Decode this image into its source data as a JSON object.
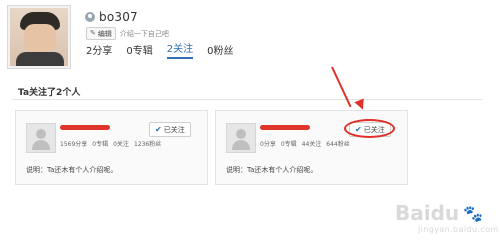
{
  "profile": {
    "username": "bo307",
    "edit_label": "编辑",
    "intro_text": "介绍一下自己吧",
    "tabs": [
      {
        "label": "2分享"
      },
      {
        "label": "0专辑"
      },
      {
        "label": "2关注"
      },
      {
        "label": "0粉丝"
      }
    ]
  },
  "following": {
    "title": "Ta关注了2个人",
    "cards": [
      {
        "stats": [
          "1569分享",
          "0专辑",
          "0关注",
          "1236粉丝"
        ],
        "follow_label": "已关注",
        "desc": "说明：Ta还木有个人介绍呢。"
      },
      {
        "stats": [
          "0分享",
          "0专辑",
          "44关注",
          "644粉丝"
        ],
        "follow_label": "已关注",
        "desc": "说明：Ta还木有个人介绍呢。"
      }
    ]
  },
  "watermark": {
    "brand": "Baidu",
    "sub": "jingyan.baidu.com"
  },
  "colors": {
    "accent": "#2f6fb5",
    "annotation": "#e0302a"
  }
}
